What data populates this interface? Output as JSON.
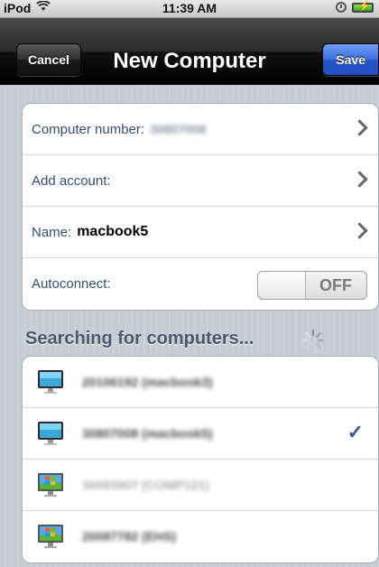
{
  "status_bar": {
    "carrier": "iPod",
    "wifi_icon": "wifi-icon",
    "time": "11:39 AM"
  },
  "nav": {
    "title": "New Computer",
    "cancel_label": "Cancel",
    "save_label": "Save"
  },
  "form": {
    "computer_number_label": "Computer number:",
    "computer_number_value": "30807008",
    "add_account_label": "Add account:",
    "name_label": "Name:",
    "name_value": "macbook5",
    "autoconnect_label": "Autoconnect:",
    "autoconnect_state": "OFF"
  },
  "search": {
    "header": "Searching for computers..."
  },
  "computers": [
    {
      "name": "20106192 (macbook3)",
      "icon": "mac-monitor-icon",
      "selected": false
    },
    {
      "name": "30807008 (macbook5)",
      "icon": "mac-monitor-icon",
      "selected": true
    },
    {
      "name": "30093907 (COMP121)",
      "icon": "windows-monitor-icon",
      "selected": false
    },
    {
      "name": "20087782 (EHS)",
      "icon": "windows-monitor-icon",
      "selected": false
    }
  ],
  "colors": {
    "nav_bg": "#000000",
    "save_blue": "#2756c9",
    "label_blue": "#2f4f78",
    "checkmark": "#3a5a96"
  }
}
